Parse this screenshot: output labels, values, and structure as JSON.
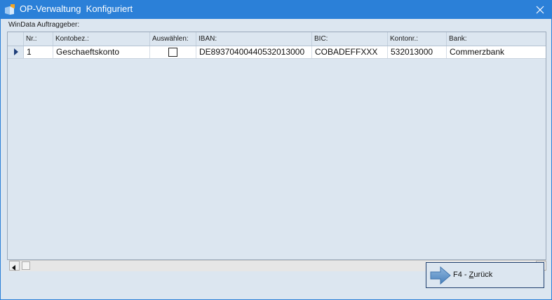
{
  "window": {
    "title": "OP-Verwaltung  Konfiguriert",
    "app_icon": "app-icon",
    "close_icon": "close-icon"
  },
  "group": {
    "label": "WinData Auftraggeber:"
  },
  "table": {
    "columns": [
      "Nr.:",
      "Kontobez.:",
      "Auswählen:",
      "IBAN:",
      "BIC:",
      "Kontonr.:",
      "Bank:"
    ],
    "rows": [
      {
        "nr": "1",
        "kontobez": "Geschaeftskonto",
        "auswaehlen": false,
        "iban": "DE89370400440532013000",
        "bic": "COBADEFFXXX",
        "kontonr": "532013000",
        "bank": "Commerzbank"
      }
    ],
    "row_indicator_icon": "row-pointer-icon"
  },
  "scrollbar": {
    "left_icon": "arrow-left-icon",
    "right_icon": "arrow-right-icon"
  },
  "footer": {
    "back_label_pre": "F4 - ",
    "back_label_ul": "Z",
    "back_label_post": "urück",
    "back_icon": "arrow-right-icon"
  },
  "colors": {
    "titlebar": "#2b80d8",
    "client": "#dce6f0",
    "row_background": "#ffffff"
  }
}
